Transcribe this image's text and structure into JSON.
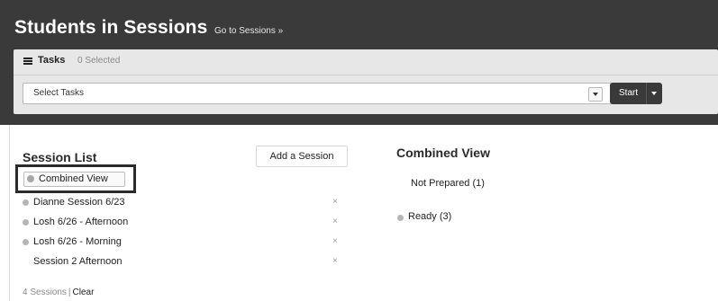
{
  "header": {
    "title": "Students in Sessions",
    "goto_link": "Go to Sessions »"
  },
  "tasks": {
    "label": "Tasks",
    "selected_count": "0 Selected",
    "select_placeholder": "Select Tasks",
    "start_label": "Start"
  },
  "session_list": {
    "title": "Session List",
    "add_label": "Add a Session",
    "combined_item": "Combined View",
    "items": [
      {
        "label": "Dianne Session 6/23",
        "has_dot": true
      },
      {
        "label": "Losh 6/26 - Afternoon",
        "has_dot": true
      },
      {
        "label": "Losh 6/26 - Morning",
        "has_dot": true
      },
      {
        "label": "Session 2 Afternoon",
        "has_dot": false
      }
    ],
    "remove_glyph": "×",
    "footer_count": "4 Sessions",
    "footer_sep": "|",
    "footer_clear": "Clear"
  },
  "combined_view": {
    "title": "Combined View",
    "not_prepared": "Not Prepared (1)",
    "ready": "Ready (3)"
  },
  "colors": {
    "header_bg": "#3a3a3a",
    "panel_bg": "#e7e7e7",
    "start_bg": "#3a3a3a",
    "dot": "#b5b5b5"
  },
  "icons": {
    "tasks": "list-icon",
    "select_caret": "chevron-down-icon",
    "start_caret": "chevron-down-icon",
    "remove": "close-icon",
    "status_dot": "dot-icon"
  }
}
